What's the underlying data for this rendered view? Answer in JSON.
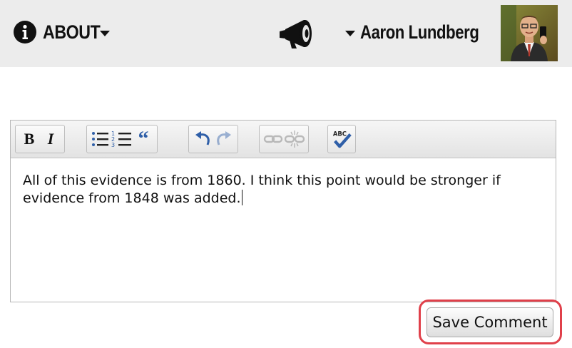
{
  "header": {
    "about_label": "ABOUT",
    "user_name": "Aaron Lundberg",
    "icons": {
      "about": "info-circle-icon",
      "about_menu": "caret-down-icon",
      "announcements": "megaphone-icon",
      "user_menu": "caret-down-icon",
      "avatar": "user-avatar"
    }
  },
  "editor": {
    "toolbar": {
      "bold_label": "B",
      "italic_label": "I",
      "quote_label": "“",
      "spellcheck_label": "ABC",
      "buttons": [
        "bold",
        "italic",
        "bulleted-list",
        "numbered-list",
        "blockquote",
        "undo",
        "redo",
        "link",
        "unlink",
        "spellcheck"
      ],
      "disabled": [
        "redo",
        "link",
        "unlink"
      ]
    },
    "content": "All of this evidence is from 1860. I think this point would be stronger if evidence from 1848 was added."
  },
  "actions": {
    "save_label": "Save Comment"
  },
  "colors": {
    "header_bg": "#ececec",
    "highlight": "#e0404a",
    "toolbar_icon": "#2f5fa8"
  }
}
